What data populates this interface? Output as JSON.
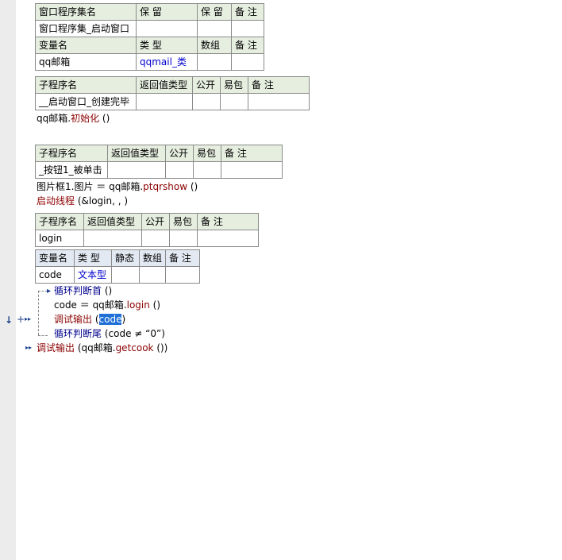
{
  "assembly_table": {
    "header": [
      "窗口程序集名",
      "保 留",
      "保 留",
      "备 注"
    ],
    "row": [
      "窗口程序集_启动窗口",
      "",
      "",
      ""
    ],
    "var_header": [
      "变量名",
      "类 型",
      "数组",
      "备 注"
    ],
    "var_row": [
      "qq邮箱",
      "qqmail_类",
      "",
      ""
    ]
  },
  "sub1": {
    "header": [
      "子程序名",
      "返回值类型",
      "公开",
      "易包",
      "备 注"
    ],
    "row": [
      "__启动窗口_创建完毕",
      "",
      "",
      "",
      ""
    ],
    "code": {
      "obj": "qq邮箱.",
      "method": "初始化",
      "args": " ()"
    }
  },
  "sub2": {
    "header": [
      "子程序名",
      "返回值类型",
      "公开",
      "易包",
      "备 注"
    ],
    "row": [
      "_按钮1_被单击",
      "",
      "",
      "",
      ""
    ],
    "code1": {
      "lhs": "图片框1.图片 ＝ qq邮箱.",
      "method": "ptqrshow",
      "args": " ()"
    },
    "code2": {
      "cmd": "启动线程",
      "args": " (&login, , )"
    }
  },
  "sub3": {
    "header": [
      "子程序名",
      "返回值类型",
      "公开",
      "易包",
      "备 注"
    ],
    "row": [
      "login",
      "",
      "",
      "",
      ""
    ],
    "var_header": [
      "变量名",
      "类 型",
      "静态",
      "数组",
      "备 注"
    ],
    "var_row": [
      "code",
      "文本型",
      "",
      "",
      ""
    ],
    "loop_start": {
      "cmd": "循环判断首",
      "args": " ()"
    },
    "assign": {
      "lhs": "code ＝ qq邮箱.",
      "method": "login",
      "args": " ()"
    },
    "debug1": {
      "cmd": "调试输出",
      "open": " (",
      "arg": "code",
      "close": ")"
    },
    "loop_end": {
      "cmd": "循环判断尾",
      "args": " (code ≠ “0”)"
    },
    "debug2": {
      "cmd": "调试输出",
      "open": " (qq邮箱.",
      "method": "getcook",
      "close": " ())"
    }
  },
  "gutter_icons": {
    "down": "↓",
    "plus": "+",
    "expand": "▸▸"
  }
}
